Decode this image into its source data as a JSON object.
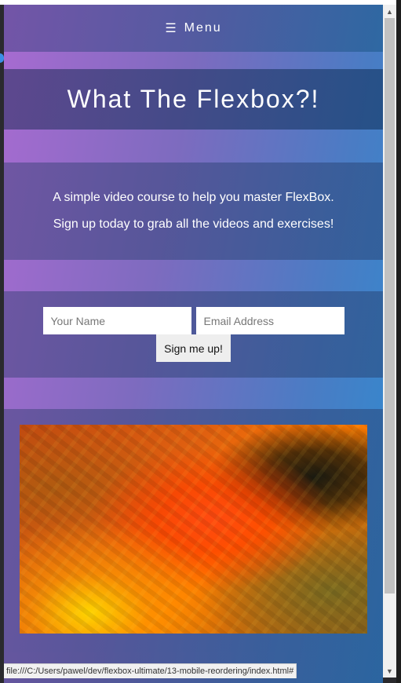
{
  "nav": {
    "menu_icon": "☰",
    "menu_label": "Menu"
  },
  "hero": {
    "title": "What The Flexbox?!"
  },
  "intro": {
    "line1": "A simple video course to help you master FlexBox.",
    "line2": "Sign up today to grab all the videos and exercises!"
  },
  "signup": {
    "name_placeholder": "Your Name",
    "email_placeholder": "Email Address",
    "button_label": "Sign me up!"
  },
  "media": {
    "icon": "video-thumbnail"
  },
  "scrollbar": {
    "up": "▲",
    "down": "▼"
  },
  "statusbar": {
    "url": "file:///C:/Users/pawel/dev/flexbox-ultimate/13-mobile-reordering/index.html#"
  },
  "colors": {
    "accent_purple": "#a86bd1",
    "accent_blue": "#2f8bd0",
    "hero_text": "#ffffff"
  }
}
